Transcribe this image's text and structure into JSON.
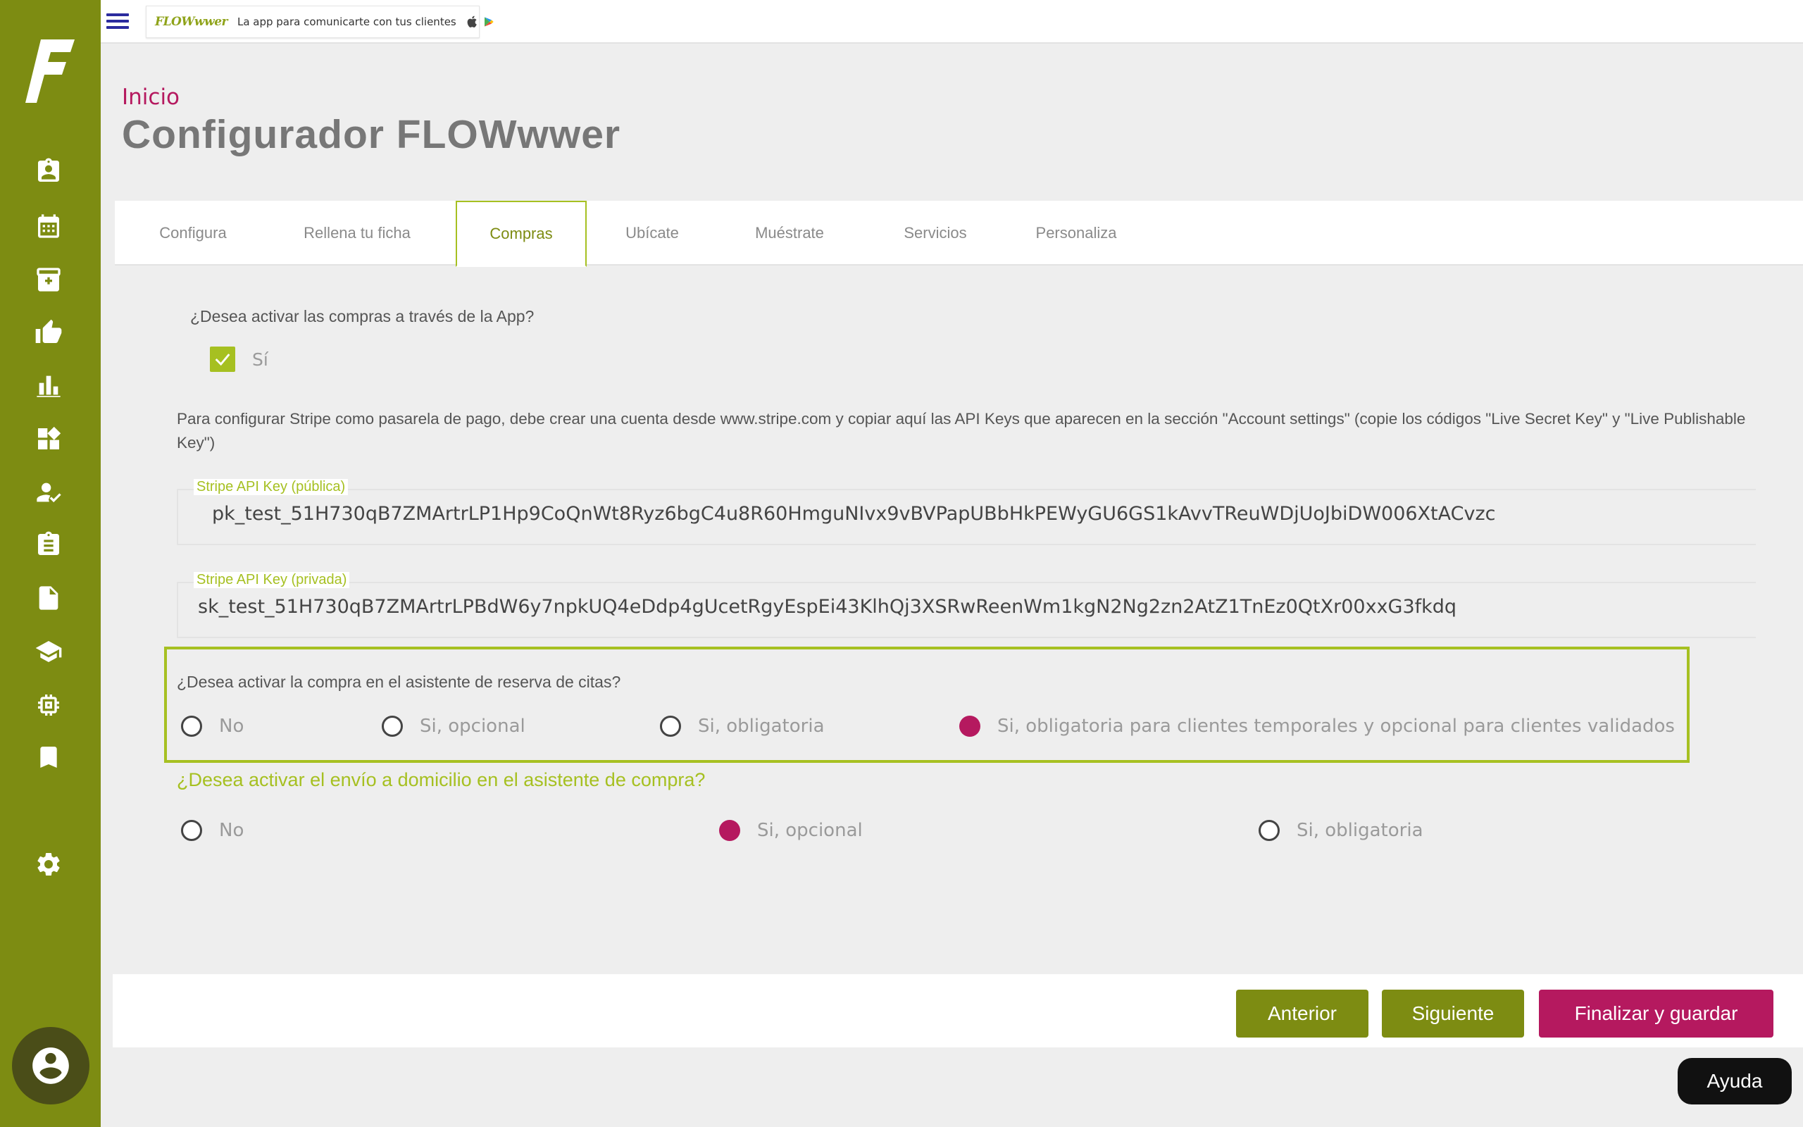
{
  "promo": {
    "brand": "FLOWwwer",
    "text": "La app para comunicarte con tus clientes"
  },
  "header": {
    "breadcrumb": "Inicio",
    "title": "Configurador FLOWwwer"
  },
  "tabs": [
    {
      "label": "Configura"
    },
    {
      "label": "Rellena tu ficha"
    },
    {
      "label": "Compras",
      "active": true
    },
    {
      "label": "Ubícate"
    },
    {
      "label": "Muéstrate"
    },
    {
      "label": "Servicios"
    },
    {
      "label": "Personaliza"
    }
  ],
  "purchases": {
    "question": "¿Desea activar las compras a través de la App?",
    "checkbox_label": "Sí",
    "checked": true,
    "info": "Para configurar Stripe como pasarela de pago, debe crear una cuenta desde www.stripe.com y copiar aquí las API Keys que aparecen en la sección \"Account settings\" (copie los códigos \"Live Secret Key\" y \"Live Publishable Key\")"
  },
  "fields": {
    "public_key": {
      "label": "Stripe API Key (pública)",
      "value": "pk_test_51H730qB7ZMArtrLP1Hp9CoQnWt8Ryz6bgC4u8R60HmguNIvx9vBVPapUBbHkPEWyGU6GS1kAvvTReuWDjUoJbiDW006XtACvzc"
    },
    "private_key": {
      "label": "Stripe API Key (privada)",
      "value": "sk_test_51H730qB7ZMArtrLPBdW6y7npkUQ4eDdp4gUcetRgyEspEi43KlhQj3XSRwReenWm1kgN2Ng2zn2AtZ1TnEz0QtXr00xxG3fkdq"
    }
  },
  "booking": {
    "question": "¿Desea activar la compra en el asistente de reserva de citas?",
    "options": [
      "No",
      "Si, opcional",
      "Si, obligatoria",
      "Si, obligatoria para clientes temporales y opcional para clientes validados"
    ],
    "selected": 3
  },
  "delivery": {
    "question": "¿Desea activar el envío a domicilio en el asistente de compra?",
    "options": [
      "No",
      "Si, opcional",
      "Si, obligatoria"
    ],
    "selected": 1
  },
  "buttons": {
    "prev": "Anterior",
    "next": "Siguiente",
    "finish": "Finalizar y guardar",
    "help": "Ayuda"
  },
  "colors": {
    "sidebar": "#7d8c12",
    "accent_green": "#a6c021",
    "accent_magenta": "#b5195f"
  },
  "sidebar_icons": [
    "contact-card-icon",
    "calendar-icon",
    "archive-box-icon",
    "thumbs-up-icon",
    "bar-chart-icon",
    "widgets-icon",
    "user-check-icon",
    "clipboard-icon",
    "document-icon",
    "graduation-cap-icon",
    "chip-icon",
    "bookmark-icon",
    "gear-icon"
  ]
}
